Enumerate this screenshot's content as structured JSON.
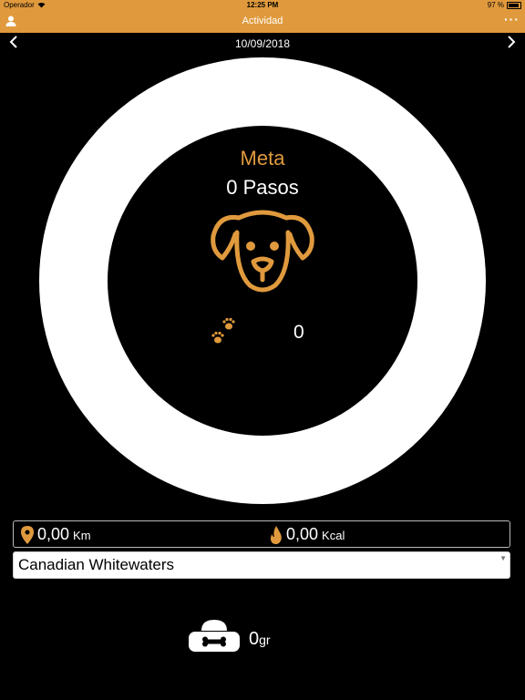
{
  "status_bar": {
    "carrier": "Operador",
    "time": "12:25 PM",
    "battery": "97 %"
  },
  "nav_bar": {
    "title": "Actividad",
    "more": "···"
  },
  "date_nav": {
    "date": "10/09/2018"
  },
  "goal": {
    "label": "Meta",
    "steps": "0 Pasos",
    "paw_count": "0"
  },
  "stats": {
    "distance": {
      "value": "0,00",
      "unit": "Km"
    },
    "calories": {
      "value": "0,00",
      "unit": "Kcal"
    }
  },
  "dog_picker": {
    "selected": "Canadian Whitewaters"
  },
  "food": {
    "value": "0",
    "unit": "gr"
  },
  "colors": {
    "accent": "#e09a3d",
    "background": "#000000",
    "ring": "#ffffff"
  },
  "icons": [
    "user-icon",
    "more-icon",
    "chevron-left-icon",
    "chevron-right-icon",
    "dog-icon",
    "paw-prints-icon",
    "location-pin-icon",
    "flame-icon",
    "dog-bowl-icon"
  ]
}
